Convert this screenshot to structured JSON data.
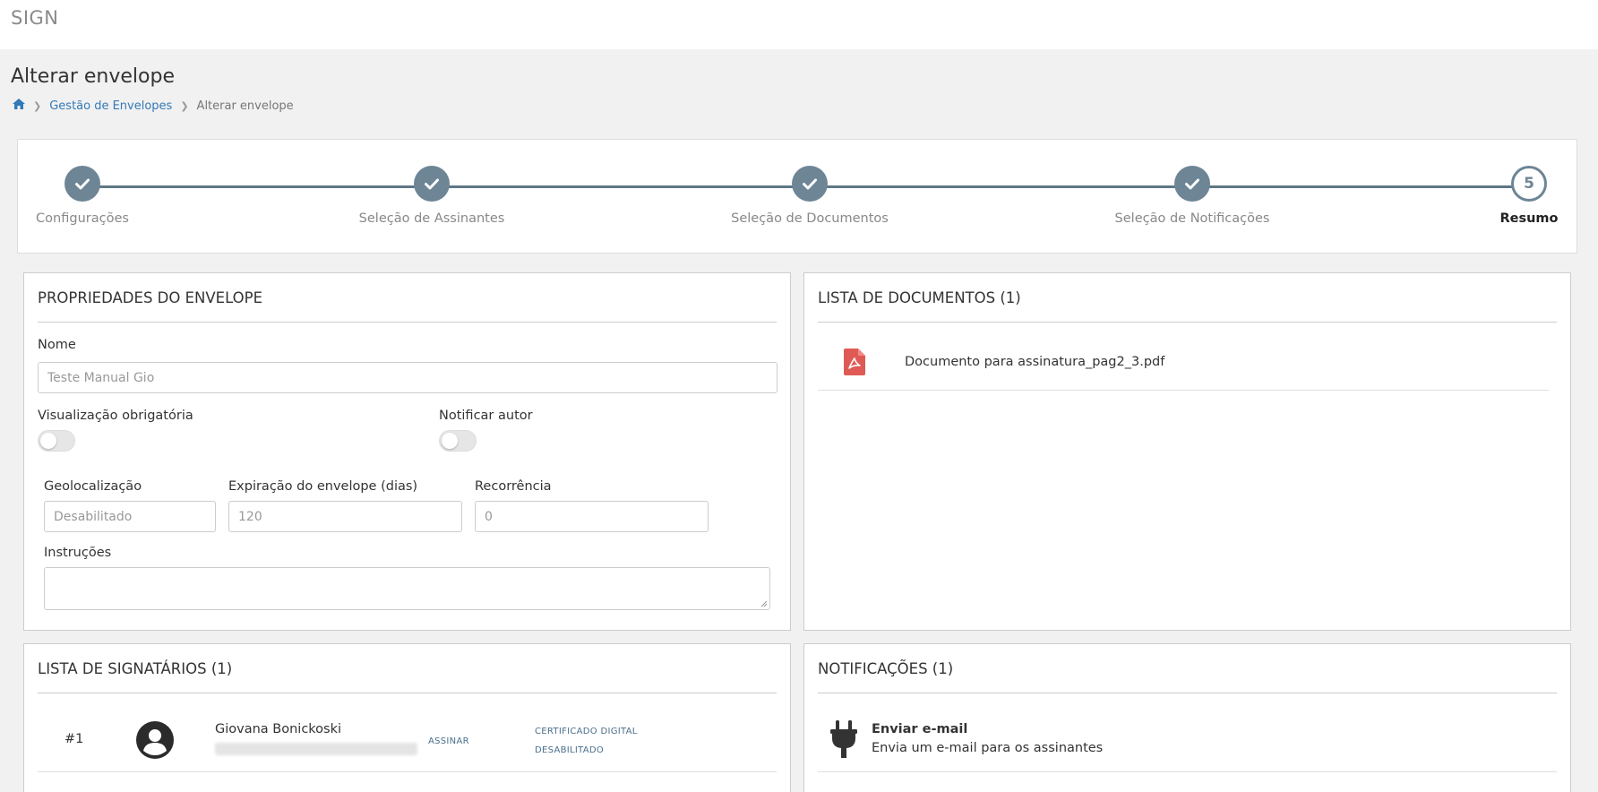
{
  "app": {
    "brand": "SIGN"
  },
  "page": {
    "title": "Alterar envelope"
  },
  "breadcrumb": {
    "items": [
      "Gestão de Envelopes",
      "Alterar envelope"
    ]
  },
  "stepper": {
    "steps": [
      {
        "label": "Configurações",
        "state": "done"
      },
      {
        "label": "Seleção de Assinantes",
        "state": "done"
      },
      {
        "label": "Seleção de Documentos",
        "state": "done"
      },
      {
        "label": "Seleção de Notificações",
        "state": "done"
      },
      {
        "label": "Resumo",
        "state": "current",
        "number": "5"
      }
    ]
  },
  "properties": {
    "title": "PROPRIEDADES DO ENVELOPE",
    "name_label": "Nome",
    "name_value": "Teste Manual Gio",
    "mandatory_view_label": "Visualização obrigatória",
    "mandatory_view_on": false,
    "notify_author_label": "Notificar autor",
    "notify_author_on": false,
    "geolocation_label": "Geolocalização",
    "geolocation_value": "Desabilitado",
    "expiration_label": "Expiração do envelope (dias)",
    "expiration_value": "120",
    "recurrence_label": "Recorrência",
    "recurrence_value": "0",
    "instructions_label": "Instruções",
    "instructions_value": ""
  },
  "documents": {
    "title": "LISTA DE DOCUMENTOS (1)",
    "items": [
      {
        "name": "Documento para assinatura_pag2_3.pdf",
        "icon": "pdf-icon"
      }
    ]
  },
  "signers": {
    "title": "LISTA DE SIGNATÁRIOS (1)",
    "items": [
      {
        "index": "#1",
        "name": "Giovana Bonickoski",
        "action": "ASSINAR",
        "cert_line1": "CERTIFICADO DIGITAL",
        "cert_line2": "DESABILITADO"
      }
    ]
  },
  "notifications": {
    "title": "NOTIFICAÇÕES (1)",
    "items": [
      {
        "title": "Enviar e-mail",
        "description": "Envia um e-mail para os assinantes",
        "icon": "plug-icon"
      }
    ]
  },
  "colors": {
    "accent": "#6d8595",
    "link": "#337ab7",
    "pdf": "#e05a55"
  }
}
